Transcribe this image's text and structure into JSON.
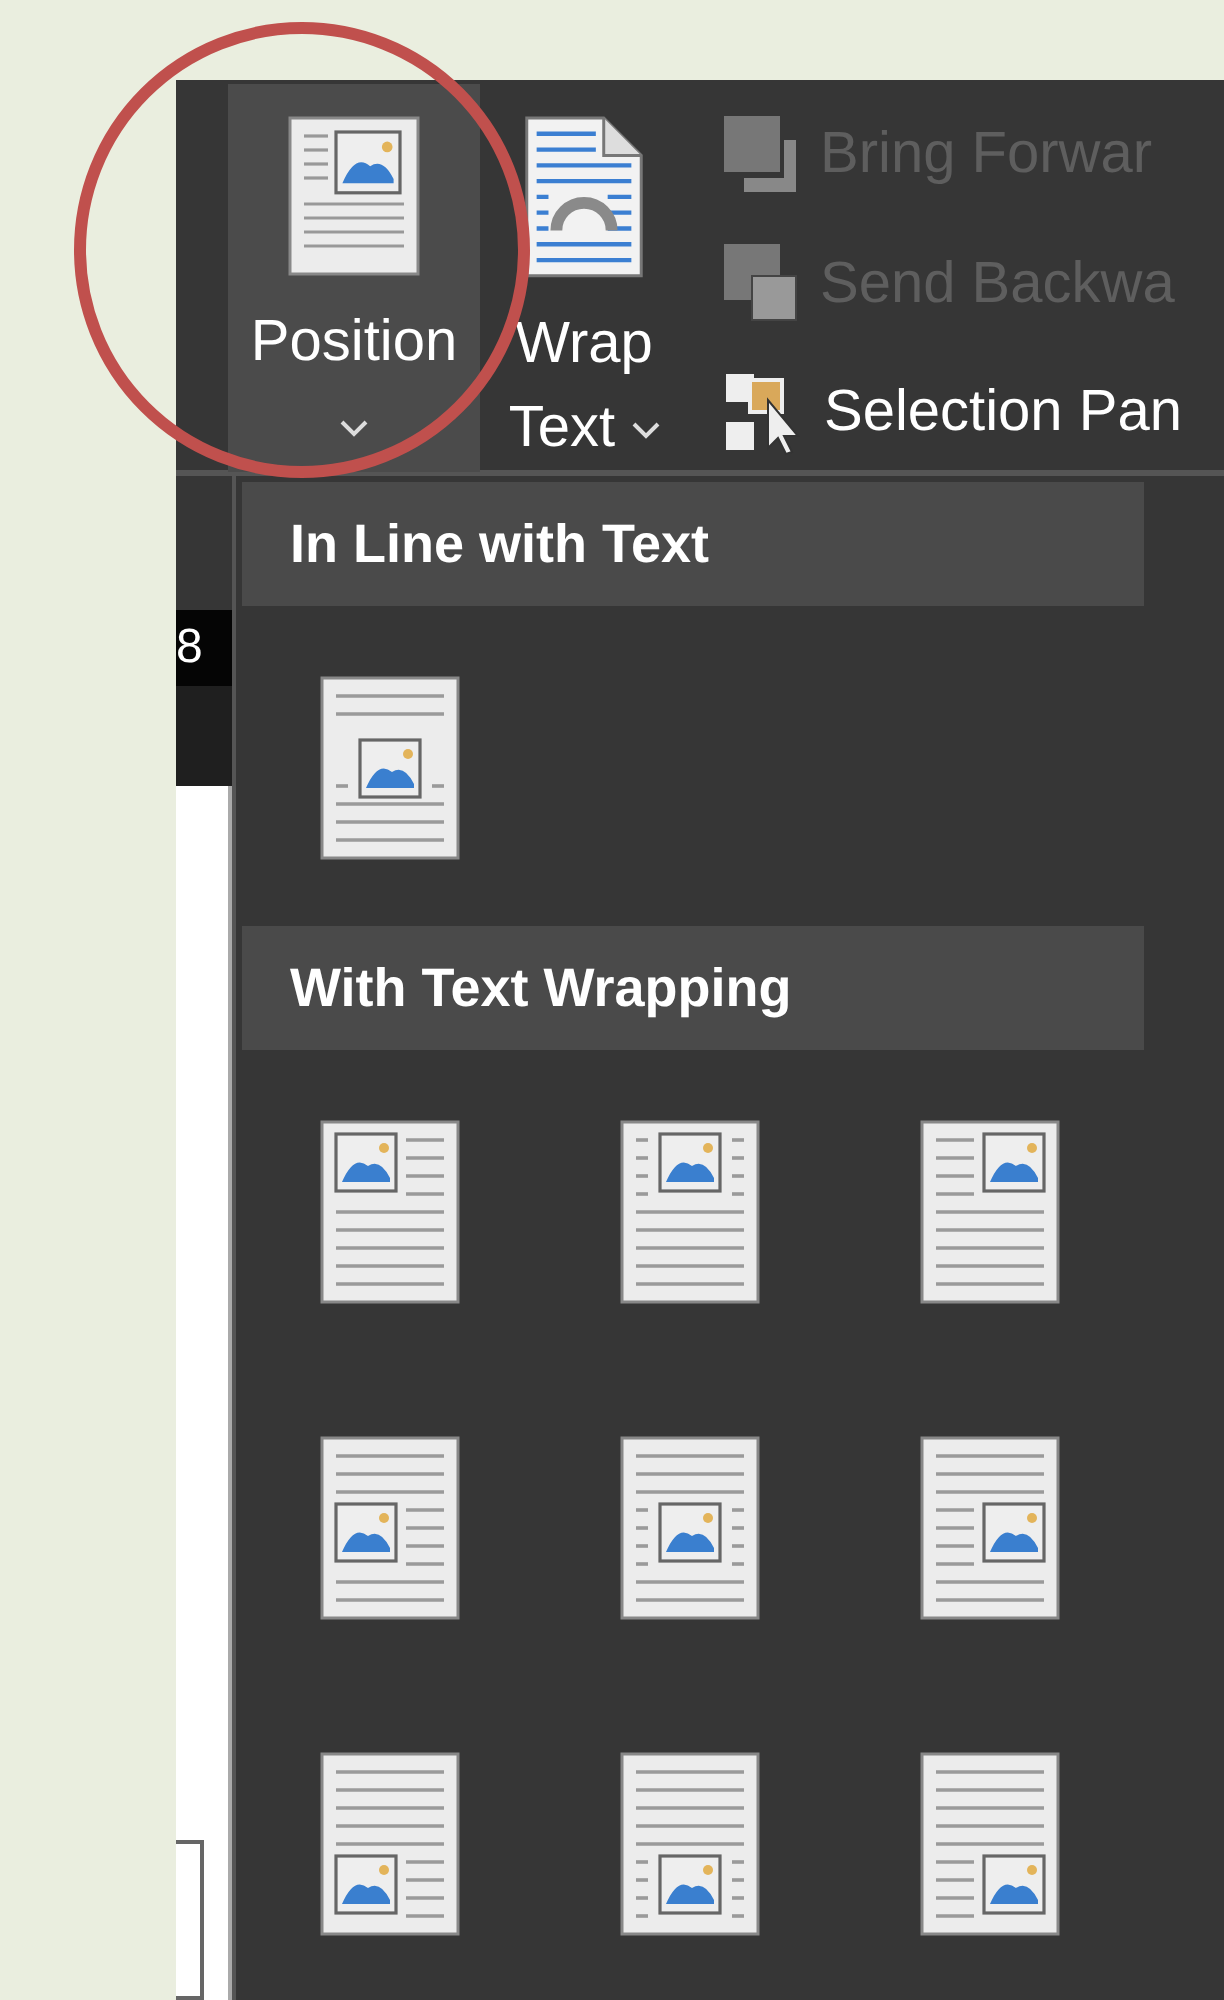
{
  "ribbon": {
    "large_buttons": [
      {
        "kind": "position",
        "label": "Position",
        "selected": true
      },
      {
        "kind": "wrap",
        "label": "Wrap",
        "label_2": "Text",
        "selected": false
      }
    ],
    "small_buttons": [
      {
        "kind": "bring",
        "label": "Bring Forwar",
        "disabled": true
      },
      {
        "kind": "send",
        "label": "Send Backwa",
        "disabled": true
      },
      {
        "kind": "selection",
        "label": "Selection Pan",
        "disabled": false
      }
    ]
  },
  "ruler": {
    "number": "8"
  },
  "gallery": {
    "sections": [
      {
        "title": "In Line with Text",
        "options": [
          {
            "kind": "inline"
          }
        ]
      },
      {
        "title": "With Text Wrapping",
        "options": [
          {
            "kind": "top-left"
          },
          {
            "kind": "top-center"
          },
          {
            "kind": "top-right"
          },
          {
            "kind": "middle-left"
          },
          {
            "kind": "middle-center"
          },
          {
            "kind": "middle-right"
          },
          {
            "kind": "bottom-left"
          },
          {
            "kind": "bottom-center"
          },
          {
            "kind": "bottom-right"
          }
        ]
      }
    ]
  }
}
